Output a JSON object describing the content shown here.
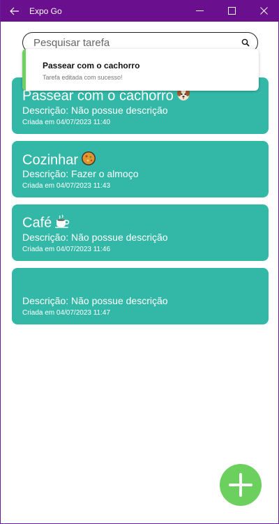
{
  "titlebar": {
    "title": "Expo Go",
    "back_icon": "arrow-left-icon",
    "minimize_icon": "minimize-icon",
    "maximize_icon": "maximize-icon",
    "close_icon": "close-icon",
    "color": "#6a0f8e"
  },
  "search": {
    "placeholder": "Pesquisar tarefa",
    "value": "",
    "icon": "search-icon"
  },
  "toast": {
    "title": "Passear com o cachorro",
    "message": "Tarefa editada com sucesso!",
    "accent": "#6fcf61"
  },
  "tasks": [
    {
      "title": "Passear com o cachorro",
      "emoji": "dog-face-icon",
      "description": "Descrição: Não possue descrição",
      "created": "Criada em 04/07/2023 11:40"
    },
    {
      "title": "Cozinhar",
      "emoji": "paella-pan-icon",
      "description": "Descrição: Fazer o almoço",
      "created": "Criada em 04/07/2023 11:43"
    },
    {
      "title": "Café",
      "emoji": "hot-beverage-icon",
      "description": "Descrição: Não possue descrição",
      "created": "Criada em 04/07/2023 11:46"
    },
    {
      "title": "",
      "emoji": "",
      "description": "Descrição: Não possue descrição",
      "created": "Criada em 04/07/2023 11:47"
    }
  ],
  "card_color": "#33b8a8",
  "fab": {
    "icon": "plus-icon",
    "color": "#6cd05f"
  }
}
